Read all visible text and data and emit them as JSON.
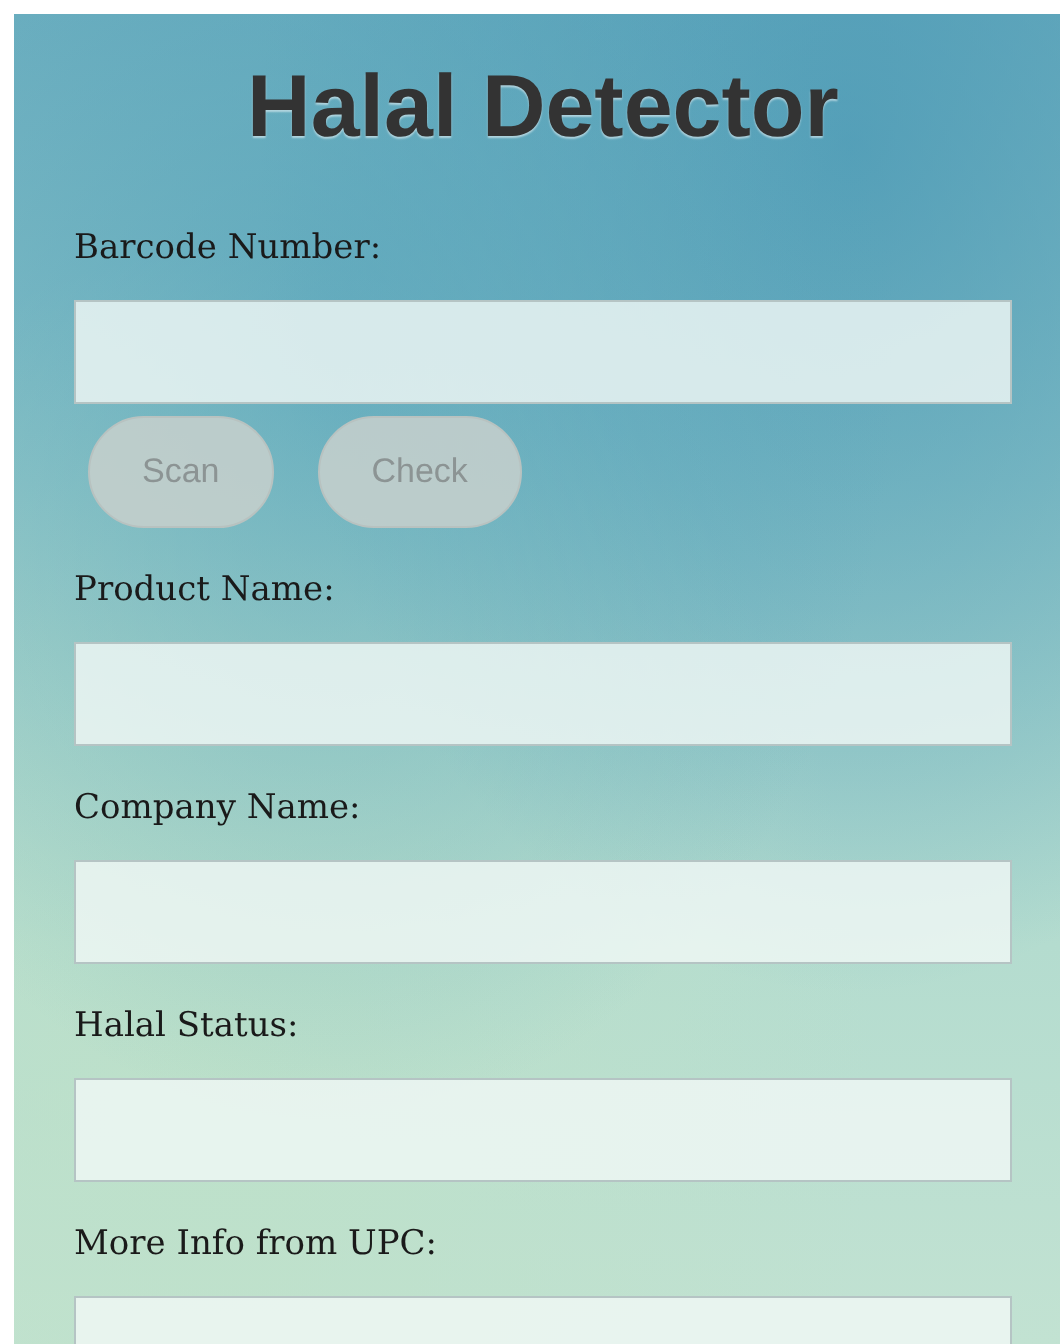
{
  "title": "Halal Detector",
  "barcode": {
    "label": "Barcode Number:"
  },
  "buttons": [
    {
      "label": "Scan",
      "disabled": true
    },
    {
      "label": "Check",
      "disabled": true
    }
  ],
  "fields": [
    {
      "label": "Product Name:"
    },
    {
      "label": "Company Name:"
    },
    {
      "label": "Halal Status:"
    },
    {
      "label": "More Info from UPC:"
    }
  ]
}
